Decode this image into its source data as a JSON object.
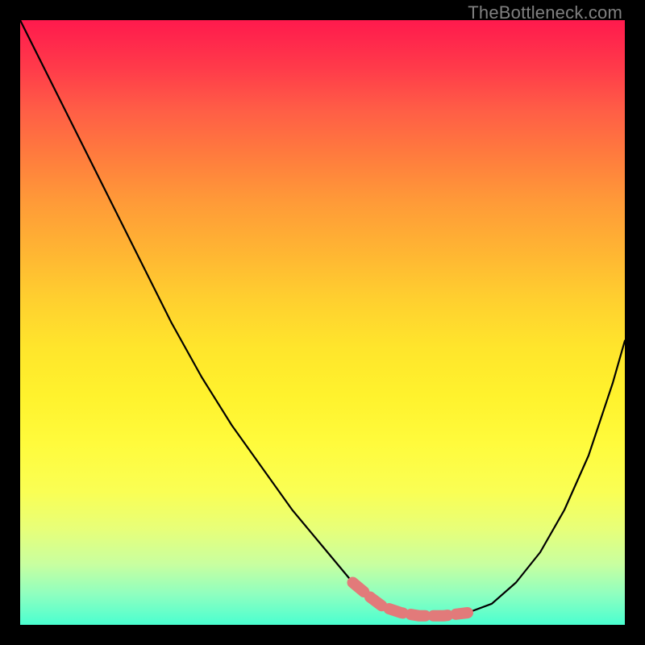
{
  "watermark": "TheBottleneck.com",
  "chart_data": {
    "type": "line",
    "title": "",
    "xlabel": "",
    "ylabel": "",
    "xlim": [
      0,
      100
    ],
    "ylim": [
      0,
      100
    ],
    "series": [
      {
        "name": "bottleneck-curve",
        "x": [
          0,
          5,
          10,
          15,
          20,
          25,
          30,
          35,
          40,
          45,
          50,
          55,
          58,
          60,
          63,
          66,
          70,
          74,
          78,
          82,
          86,
          90,
          94,
          98,
          100
        ],
        "values": [
          100,
          90,
          80,
          70,
          60,
          50,
          41,
          33,
          26,
          19,
          13,
          7,
          4.5,
          3,
          2,
          1.5,
          1.5,
          2,
          3.5,
          7,
          12,
          19,
          28,
          40,
          47
        ]
      }
    ],
    "annotations": [
      {
        "name": "highlight-segment",
        "type": "thick-stroke",
        "color": "#e27a7a",
        "x": [
          55,
          58,
          60,
          63,
          66,
          70,
          74
        ],
        "values": [
          7,
          4.5,
          3,
          2,
          1.5,
          1.5,
          2
        ]
      }
    ],
    "gradient_stops": [
      {
        "pct": 0,
        "color": "#ff1a4d"
      },
      {
        "pct": 25,
        "color": "#ff9a38"
      },
      {
        "pct": 55,
        "color": "#ffe52c"
      },
      {
        "pct": 85,
        "color": "#e8ff78"
      },
      {
        "pct": 100,
        "color": "#4affd0"
      }
    ]
  }
}
